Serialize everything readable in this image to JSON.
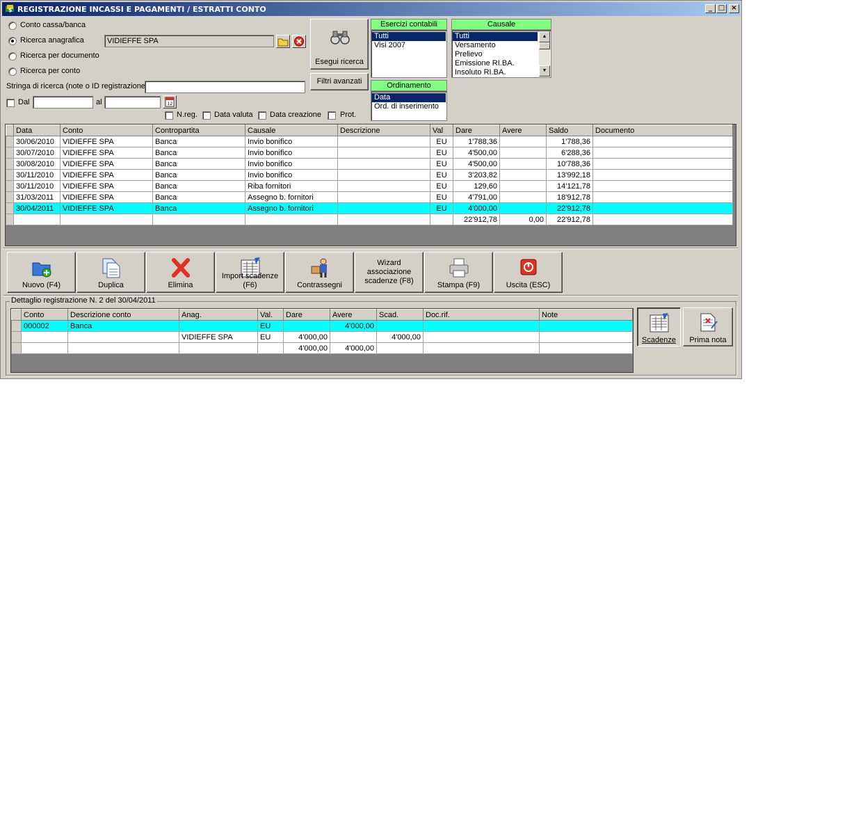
{
  "window": {
    "title": "REGISTRAZIONE INCASSI E PAGAMENTI / ESTRATTI CONTO",
    "min": "_",
    "max": "□",
    "close": "×"
  },
  "search": {
    "options": [
      "Conto cassa/banca",
      "Ricerca anagrafica",
      "Ricerca per documento",
      "Ricerca per conto"
    ],
    "selected_option": "Ricerca anagrafica",
    "anagrafica_value": "VIDIEFFE SPA",
    "string_label": "Stringa di ricerca (note o ID registrazione)",
    "string_value": "",
    "dal_label": "Dal",
    "dal_value": "",
    "al_label": "al",
    "al_value": "",
    "checks": [
      "N.reg.",
      "Data valuta",
      "Data creazione",
      "Prot."
    ],
    "execute_label": "Esegui ricerca",
    "advanced_label": "Filtri avanzati"
  },
  "esercizi": {
    "header": "Esercizi contabili",
    "items": [
      "Tutti",
      "Visi 2007"
    ],
    "selected": 0
  },
  "ordinamento": {
    "header": "Ordinamento",
    "items": [
      "Data",
      "Ord. di inserimento"
    ],
    "selected": 0
  },
  "causale": {
    "header": "Causale",
    "items": [
      "Tutti",
      "Versamento",
      "Prelievo",
      "Emissione RI.BA.",
      "Insoluto RI.BA."
    ],
    "selected": 0
  },
  "main_table": {
    "columns": [
      "Data",
      "Conto",
      "Contropartita",
      "Causale",
      "Descrizione",
      "Val",
      "Dare",
      "Avere",
      "Saldo",
      "Documento"
    ],
    "rows": [
      [
        "30/06/2010",
        "VIDIEFFE SPA",
        "Banca",
        "Invio bonifico",
        "",
        "EU",
        "1'788,36",
        "",
        "1'788,36",
        ""
      ],
      [
        "30/07/2010",
        "VIDIEFFE SPA",
        "Banca",
        "Invio bonifico",
        "",
        "EU",
        "4'500,00",
        "",
        "6'288,36",
        ""
      ],
      [
        "30/08/2010",
        "VIDIEFFE SPA",
        "Banca",
        "Invio bonifico",
        "",
        "EU",
        "4'500,00",
        "",
        "10'788,36",
        ""
      ],
      [
        "30/11/2010",
        "VIDIEFFE SPA",
        "Banca",
        "Invio bonifico",
        "",
        "EU",
        "3'203,82",
        "",
        "13'992,18",
        ""
      ],
      [
        "30/11/2010",
        "VIDIEFFE SPA",
        "Banca",
        "Riba fornitori",
        "",
        "EU",
        "129,60",
        "",
        "14'121,78",
        ""
      ],
      [
        "31/03/2011",
        "VIDIEFFE SPA",
        "Banca",
        "Assegno b. fornitori",
        "",
        "EU",
        "4'791,00",
        "",
        "18'912,78",
        ""
      ],
      [
        "30/04/2011",
        "VIDIEFFE SPA",
        "Banca",
        "Assegno b. fornitori",
        "",
        "EU",
        "4'000,00",
        "",
        "22'912,78",
        ""
      ]
    ],
    "selected_row": 6,
    "totals": [
      "",
      "",
      "",
      "",
      "",
      "",
      "22'912,78",
      "0,00",
      "22'912,78",
      ""
    ]
  },
  "toolbar": [
    {
      "label": "Nuovo (F4)",
      "icon": "new-folder-icon"
    },
    {
      "label": "Duplica",
      "icon": "duplicate-icon"
    },
    {
      "label": "Elimina",
      "icon": "delete-icon"
    },
    {
      "label": "Import scadenze (F6)",
      "icon": "import-icon"
    },
    {
      "label": "Contrassegni",
      "icon": "delivery-man-icon"
    },
    {
      "label": "Wizard associazione scadenze (F8)",
      "icon": ""
    },
    {
      "label": "Stampa (F9)",
      "icon": "printer-icon"
    },
    {
      "label": "Uscita (ESC)",
      "icon": "power-icon"
    }
  ],
  "detail": {
    "title": "Dettaglio registrazione N. 2 del 30/04/2011",
    "columns": [
      "Conto",
      "Descrizione conto",
      "Anag.",
      "Val.",
      "Dare",
      "Avere",
      "Scad.",
      "Doc.rif.",
      "Note"
    ],
    "rows": [
      [
        "000002",
        "Banca",
        "",
        "EU",
        "",
        "4'000,00",
        "",
        "",
        ""
      ],
      [
        "",
        "",
        "VIDIEFFE SPA",
        "EU",
        "4'000,00",
        "",
        "4'000,00",
        "",
        ""
      ]
    ],
    "selected_row": 0,
    "totals": [
      "",
      "",
      "",
      "",
      "4'000,00",
      "4'000,00",
      "",
      "",
      ""
    ],
    "scadenze_label": "Scadenze",
    "prima_nota_label": "Prima nota"
  }
}
